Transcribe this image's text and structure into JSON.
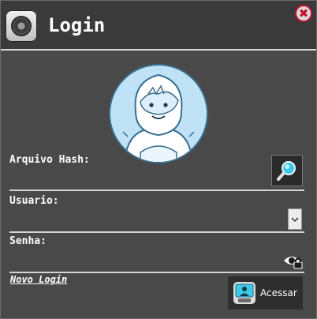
{
  "window": {
    "title": "Login",
    "close_symbol": "✖"
  },
  "form": {
    "hash_label": "Arquivo Hash:",
    "user_label": "Usuario:",
    "password_label": "Senha:",
    "new_login_link": "Novo Login",
    "submit_label": "Acessar"
  },
  "icons": {
    "app": "safe-dial-icon",
    "close": "close-icon",
    "avatar": "yeti-avatar",
    "search": "magnifier-icon",
    "dropdown": "chevron-down-icon",
    "password_toggle": "eye-lock-icon",
    "submit": "user-monitor-icon"
  },
  "colors": {
    "background": "#494949",
    "titlebar": "#3a3a3a",
    "close_red": "#c8102e",
    "avatar_blue": "#bfe2f6",
    "accent_cyan": "#3ec8e8"
  }
}
